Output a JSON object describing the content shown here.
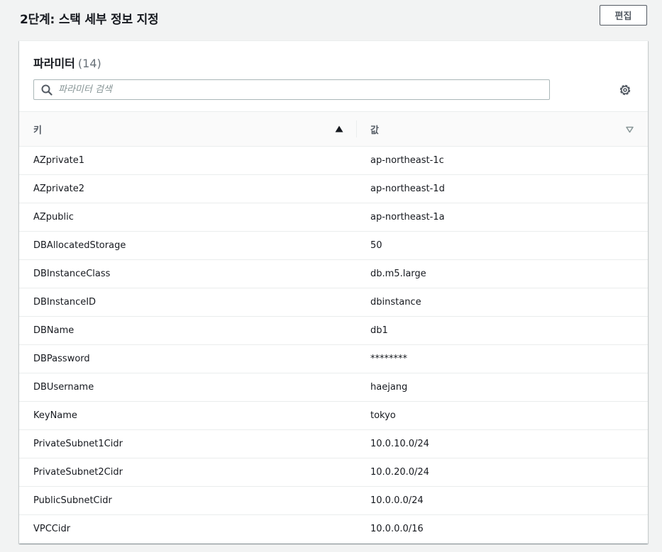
{
  "step": {
    "title": "2단계: 스택 세부 정보 지정",
    "edit_label": "편집"
  },
  "panel": {
    "title": "파라미터",
    "count": "(14)",
    "search_placeholder": "파라미터 검색",
    "search_value": ""
  },
  "table": {
    "columns": {
      "key": "키",
      "value": "값"
    },
    "rows": [
      {
        "key": "AZprivate1",
        "value": "ap-northeast-1c"
      },
      {
        "key": "AZprivate2",
        "value": "ap-northeast-1d"
      },
      {
        "key": "AZpublic",
        "value": "ap-northeast-1a"
      },
      {
        "key": "DBAllocatedStorage",
        "value": "50"
      },
      {
        "key": "DBInstanceClass",
        "value": "db.m5.large"
      },
      {
        "key": "DBInstanceID",
        "value": "dbinstance"
      },
      {
        "key": "DBName",
        "value": "db1"
      },
      {
        "key": "DBPassword",
        "value": "********"
      },
      {
        "key": "DBUsername",
        "value": "haejang"
      },
      {
        "key": "KeyName",
        "value": "tokyo"
      },
      {
        "key": "PrivateSubnet1Cidr",
        "value": "10.0.10.0/24"
      },
      {
        "key": "PrivateSubnet2Cidr",
        "value": "10.0.20.0/24"
      },
      {
        "key": "PublicSubnetCidr",
        "value": "10.0.0.0/24"
      },
      {
        "key": "VPCCidr",
        "value": "10.0.0.0/16"
      }
    ]
  },
  "icons": {
    "search": "search-icon",
    "settings": "gear-icon",
    "sort_key": "sort-ascending-icon",
    "sort_value": "sort-descending-icon"
  },
  "colors": {
    "page_bg": "#f2f3f3",
    "text": "#16191f",
    "muted": "#545b64",
    "border": "#eaeded"
  }
}
